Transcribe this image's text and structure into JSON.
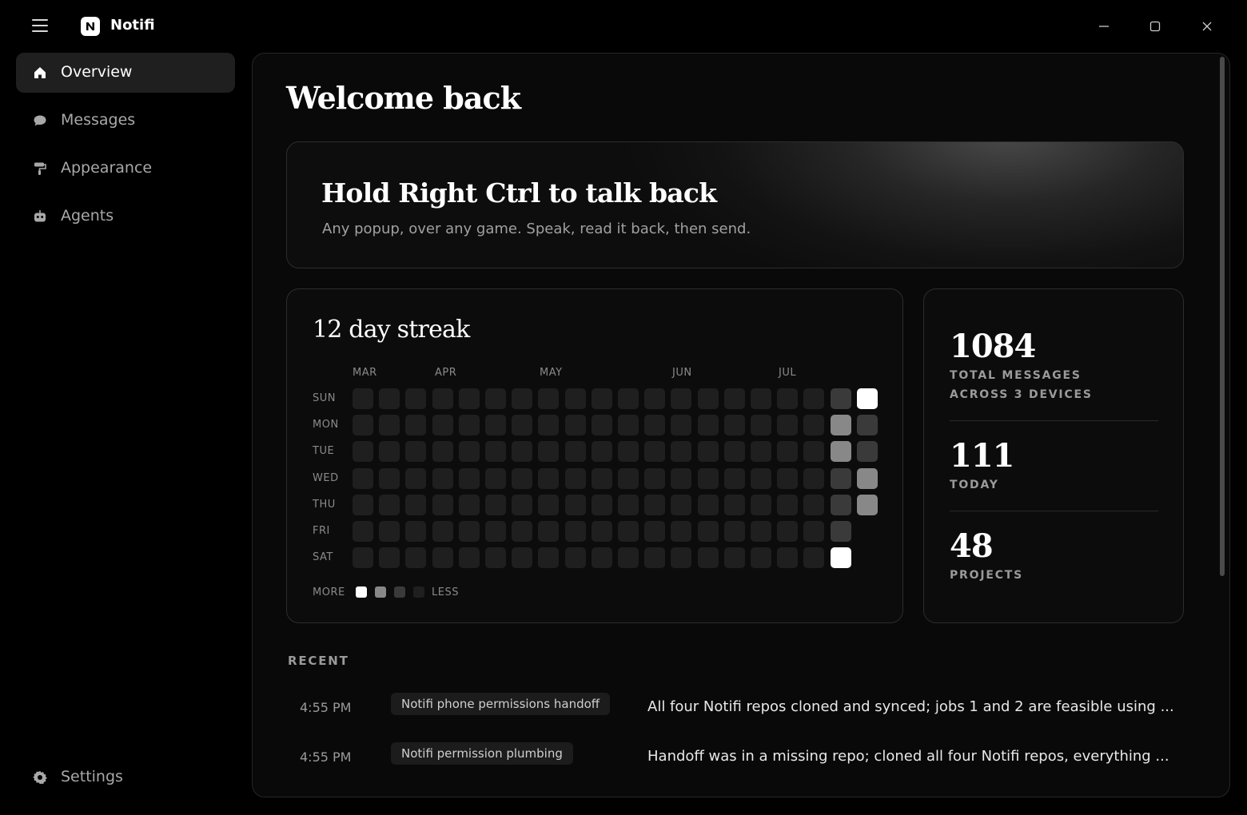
{
  "app": {
    "name": "Notifi"
  },
  "sidebar": {
    "items": [
      {
        "label": "Overview",
        "icon": "home-icon",
        "active": true
      },
      {
        "label": "Messages",
        "icon": "chat-bubble-icon",
        "active": false
      },
      {
        "label": "Appearance",
        "icon": "paint-roller-icon",
        "active": false
      },
      {
        "label": "Agents",
        "icon": "robot-icon",
        "active": false
      }
    ],
    "settings": {
      "label": "Settings",
      "icon": "gear-icon"
    }
  },
  "main": {
    "title": "Welcome back",
    "hero": {
      "title": "Hold Right Ctrl to talk back",
      "subtitle": "Any popup, over any game. Speak, read it back, then send."
    },
    "streak": {
      "title": "12 day streak",
      "months": [
        "MAR",
        "APR",
        "MAY",
        "JUN",
        "JUL"
      ],
      "days": [
        "SUN",
        "MON",
        "TUE",
        "WED",
        "THU",
        "FRI",
        "SAT"
      ],
      "legend": {
        "more": "MORE",
        "less": "LESS"
      },
      "grid_weeks": 20,
      "recent_levels": [
        [
          1,
          2,
          2,
          1,
          1,
          1,
          3
        ],
        [
          3,
          1,
          1,
          2,
          2,
          null,
          null
        ]
      ]
    },
    "stats": [
      {
        "value": "1084",
        "label_lines": [
          "TOTAL MESSAGES",
          "ACROSS 3 DEVICES"
        ]
      },
      {
        "value": "111",
        "label_lines": [
          "TODAY"
        ]
      },
      {
        "value": "48",
        "label_lines": [
          "PROJECTS"
        ]
      }
    ],
    "recent": {
      "heading": "RECENT",
      "rows": [
        {
          "time": "4:55 PM",
          "tag": "Notifi phone permissions handoff",
          "text": "All four Notifi repos cloned and synced; jobs 1 and 2 are feasible using ..."
        },
        {
          "time": "4:55 PM",
          "tag": "Notifi permission plumbing",
          "text": "Handoff was in a missing repo; cloned all four Notifi repos, everything ..."
        }
      ]
    }
  },
  "colors": {
    "background": "#000000",
    "panel": "#090909",
    "activeNav": "#1f1f1f",
    "cellEmpty": "#1f1f1f",
    "cellMid": "#888888",
    "cellMax": "#ffffff"
  }
}
